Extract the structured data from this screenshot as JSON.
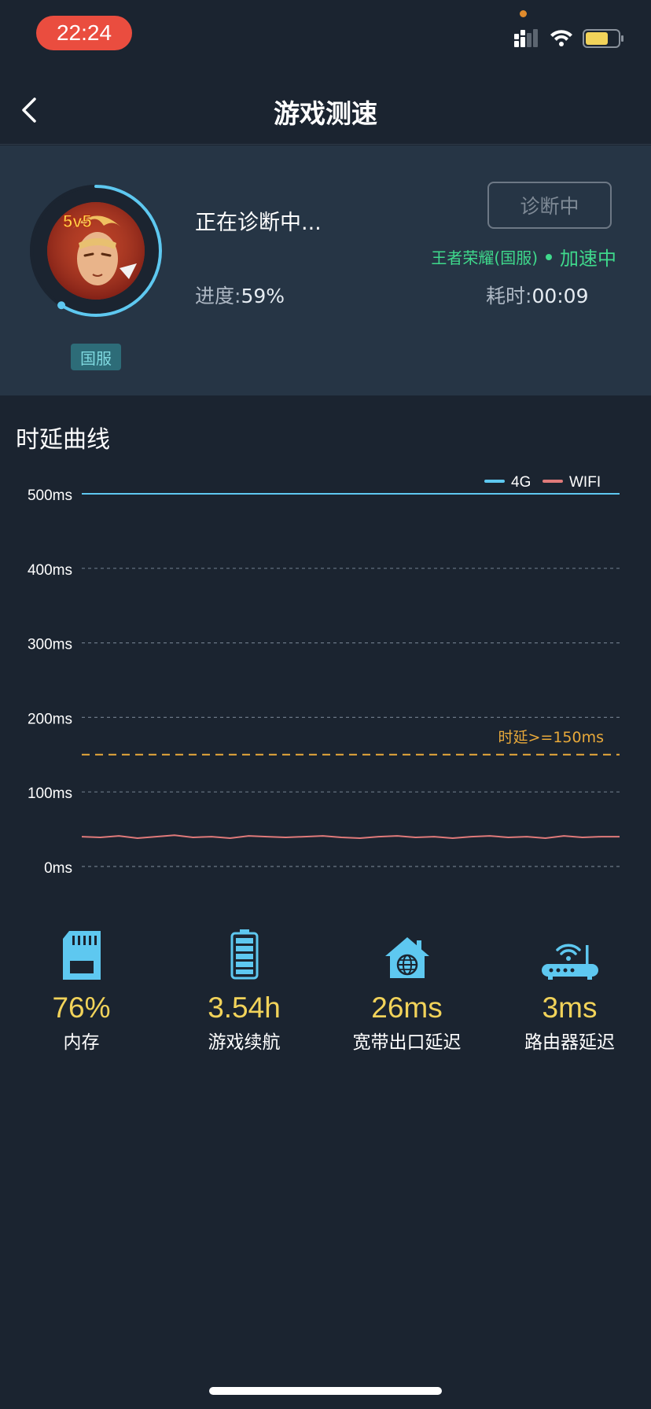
{
  "status_bar": {
    "time": "22:24"
  },
  "nav": {
    "title": "游戏测速"
  },
  "header": {
    "server_badge": "国服",
    "status_text": "正在诊断中...",
    "progress_label": "进度:",
    "progress_value": "59%",
    "progress": 0.59,
    "button_label": "诊断中",
    "game_name": "王者荣耀(国服)",
    "accel_status": "加速中",
    "elapsed_label": "耗时:",
    "elapsed_value": "00:09",
    "game_icon_text": "5v5"
  },
  "chart": {
    "section_title": "时延曲线",
    "threshold_label": "时延>=150ms",
    "legend": [
      "4G",
      "WIFI"
    ]
  },
  "chart_data": {
    "type": "line",
    "title": "时延曲线",
    "ylabel": "",
    "ylim": [
      0,
      500
    ],
    "yticks": [
      "0ms",
      "100ms",
      "200ms",
      "300ms",
      "400ms",
      "500ms"
    ],
    "grid": true,
    "legend_position": "top-right",
    "threshold": {
      "value": 150,
      "label": "时延>=150ms",
      "color": "#e8a93a"
    },
    "series": [
      {
        "name": "4G",
        "color": "#5ec8f0",
        "values": [
          500,
          500,
          500,
          500,
          500,
          500,
          500,
          500,
          500,
          500,
          500,
          500,
          500,
          500,
          500,
          500,
          500,
          500,
          500,
          500,
          500,
          500,
          500,
          500,
          500,
          500,
          500,
          500,
          500,
          500
        ]
      },
      {
        "name": "WIFI",
        "color": "#e07a7a",
        "values": [
          40,
          39,
          41,
          38,
          40,
          42,
          39,
          40,
          38,
          41,
          40,
          39,
          40,
          41,
          39,
          38,
          40,
          41,
          39,
          40,
          38,
          40,
          41,
          39,
          40,
          38,
          41,
          39,
          40,
          40
        ]
      }
    ]
  },
  "stats": [
    {
      "value": "76%",
      "label": "内存",
      "icon": "sd-card-icon"
    },
    {
      "value": "3.54h",
      "label": "游戏续航",
      "icon": "battery-icon"
    },
    {
      "value": "26ms",
      "label": "宽带出口延迟",
      "icon": "home-network-icon"
    },
    {
      "value": "3ms",
      "label": "路由器延迟",
      "icon": "router-icon"
    }
  ],
  "colors": {
    "accent_blue": "#5ec8f0",
    "wifi_red": "#e07a7a",
    "threshold_orange": "#e8a93a",
    "value_yellow": "#f2d35a",
    "accel_green": "#3fd98c"
  }
}
